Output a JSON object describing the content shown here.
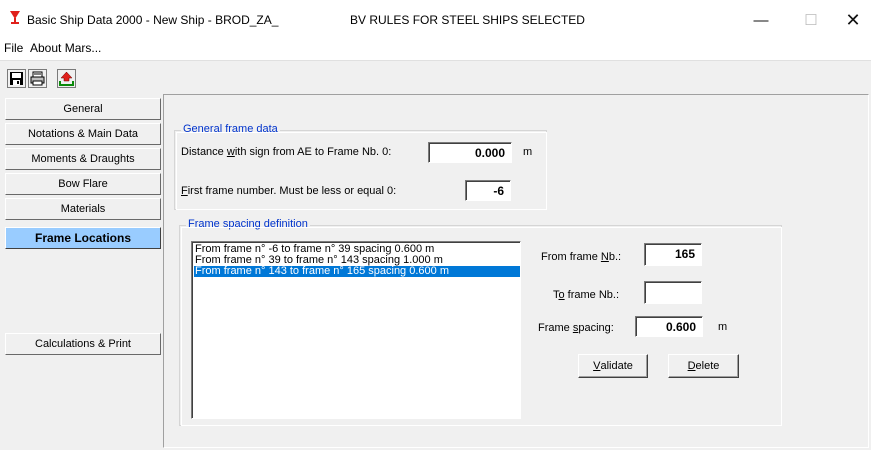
{
  "titlebar": {
    "title": "Basic Ship Data 2000 - New Ship - BROD_ZA_",
    "rules": "BV RULES FOR STEEL SHIPS SELECTED",
    "minimize": "—",
    "maximize": "☐",
    "close": "✕"
  },
  "menu": {
    "file": "File",
    "about": "About Mars..."
  },
  "toolbar": {
    "icons": [
      "save-icon",
      "print-icon",
      "export-icon"
    ]
  },
  "nav": {
    "general": "General",
    "notations": "Notations & Main Data",
    "moments": "Moments & Draughts",
    "bow_flare": "Bow Flare",
    "materials": "Materials",
    "frame_locations": "Frame Locations",
    "calculations": "Calculations & Print"
  },
  "general_frame": {
    "title": "General frame data",
    "distance_label_pre": "Distance ",
    "distance_label_u": "w",
    "distance_label_post": "ith sign from AE to Frame Nb. 0:",
    "distance_value": "0.000",
    "distance_unit": "m",
    "first_label_u": "F",
    "first_label_post": "irst frame number. Must be less or equal 0:",
    "first_value": "-6"
  },
  "frame_spacing": {
    "title": "Frame spacing definition",
    "items": [
      "From frame n° -6 to frame n° 39 spacing 0.600 m",
      "From frame n° 39 to frame n° 143 spacing 1.000 m",
      "From frame n° 143 to frame n° 165 spacing 0.600 m"
    ],
    "from_label_pre": "From frame ",
    "from_label_u": "N",
    "from_label_post": "b.:",
    "from_value": "165",
    "to_label_pre": "T",
    "to_label_u": "o",
    "to_label_post": " frame Nb.:",
    "to_value": "",
    "spacing_label_pre": "Frame ",
    "spacing_label_u": "s",
    "spacing_label_post": "pacing:",
    "spacing_value": "0.600",
    "spacing_unit": "m",
    "validate_u": "V",
    "validate_post": "alidate",
    "delete_u": "D",
    "delete_post": "elete"
  }
}
